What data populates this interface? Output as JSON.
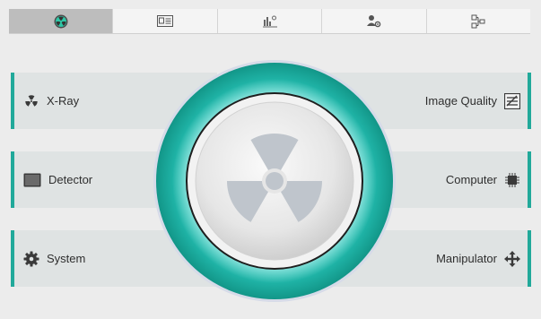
{
  "tabs": [
    {
      "icon": "radiation-tab-icon"
    },
    {
      "icon": "id-card-tab-icon"
    },
    {
      "icon": "chart-tab-icon"
    },
    {
      "icon": "user-settings-tab-icon"
    },
    {
      "icon": "network-tab-icon"
    }
  ],
  "left_panels": [
    {
      "label": "X-Ray",
      "icon": "radiation-icon"
    },
    {
      "label": "Detector",
      "icon": "monitor-icon"
    },
    {
      "label": "System",
      "icon": "gear-icon"
    }
  ],
  "right_panels": [
    {
      "label": "Image Quality",
      "icon": "image-quality-icon"
    },
    {
      "label": "Computer",
      "icon": "chip-icon"
    },
    {
      "label": "Manipulator",
      "icon": "move-arrows-icon"
    }
  ],
  "colors": {
    "accent": "#21a99a",
    "panel": "#dfe3e3",
    "background": "#ececec"
  }
}
